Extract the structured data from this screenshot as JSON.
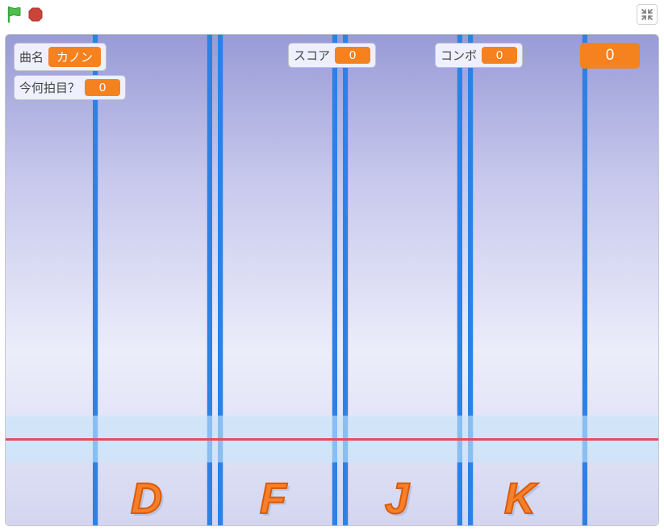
{
  "toolbar": {
    "flag_name": "green-flag-icon",
    "stop_name": "stop-icon",
    "unfull_name": "exit-fullscreen-icon"
  },
  "monitors": {
    "song": {
      "label": "曲名",
      "value": "カノン"
    },
    "beat": {
      "label": "今何拍目？",
      "value": "0"
    },
    "score": {
      "label": "スコア",
      "value": "0"
    },
    "combo": {
      "label": "コンボ",
      "value": "0"
    },
    "plain": {
      "value": "0"
    }
  },
  "keys": {
    "k1": "D",
    "k2": "F",
    "k3": "J",
    "k4": "K"
  }
}
